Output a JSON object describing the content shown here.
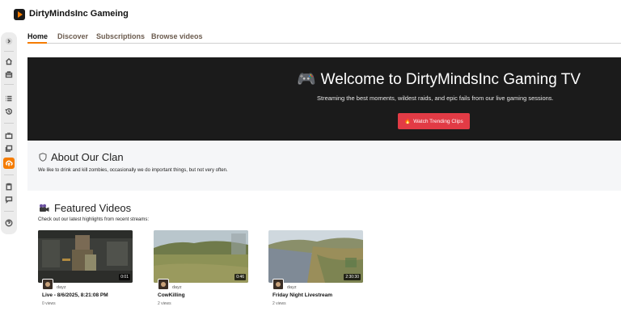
{
  "app": {
    "title": "DirtyMindsInc Gameing"
  },
  "tabs": [
    {
      "label": "Home",
      "active": true
    },
    {
      "label": "Discover",
      "active": false
    },
    {
      "label": "Subscriptions",
      "active": false
    },
    {
      "label": "Browse videos",
      "active": false
    }
  ],
  "rail": {
    "items": [
      "chevron-right-icon",
      "home-icon",
      "store-icon",
      "list-icon",
      "history-icon",
      "tv-icon",
      "library-icon",
      "upload-cloud-icon",
      "clipboard-icon",
      "chat-icon",
      "help-icon"
    ],
    "active": "upload-cloud-icon"
  },
  "hero": {
    "title": "Welcome to DirtyMindsInc Gaming TV",
    "subtitle": "Streaming the best moments, wildest raids, and epic fails from our live gaming sessions.",
    "button_label": "Watch Trending Clips"
  },
  "about": {
    "title": "About Our Clan",
    "text": "We like to drink and kill zombies, occasionally we do important things, but not very often."
  },
  "featured": {
    "title": "Featured Videos",
    "subtitle": "Check out our latest highlights from recent streams:",
    "videos": [
      {
        "channel": "dayz",
        "title": "Live - 8/6/2025, 8:21:08 PM",
        "views": "0 views",
        "duration": "0:01"
      },
      {
        "channel": "dayz",
        "title": "CowKilling",
        "views": "2 views",
        "duration": "0:46"
      },
      {
        "channel": "dayz",
        "title": "Friday Night Livestream",
        "views": "2 views",
        "duration": "2:30:30"
      }
    ]
  },
  "colors": {
    "accent": "#f57c00",
    "hero_bg": "#1b1b1b",
    "cta": "#e23b45"
  }
}
